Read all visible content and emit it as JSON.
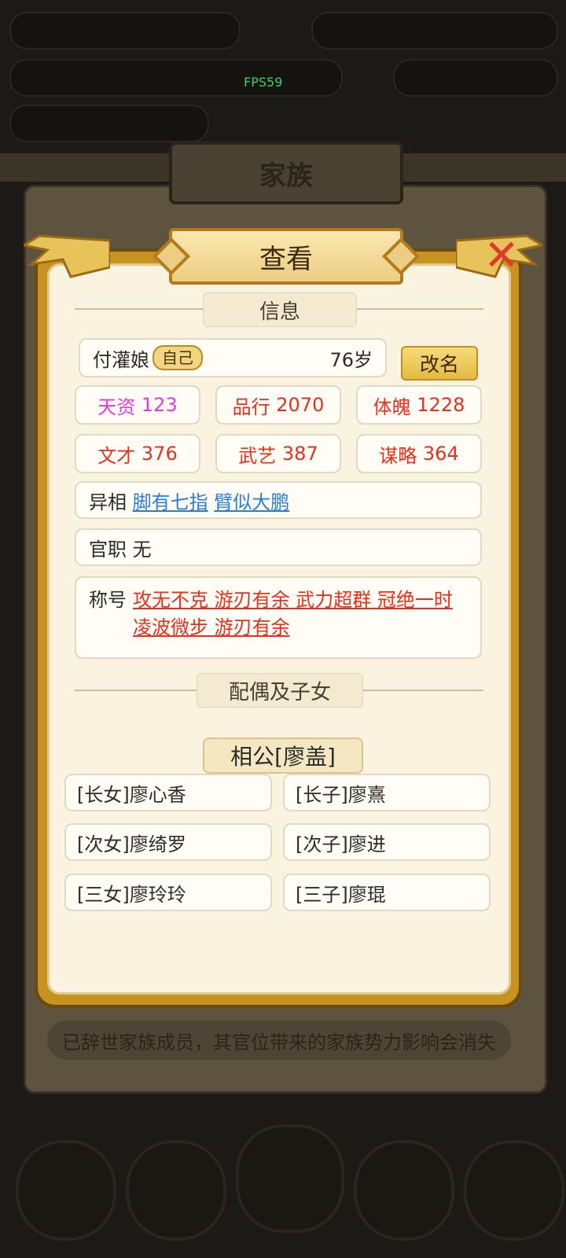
{
  "fps": "FPS59",
  "family_panel": {
    "title": "家族",
    "footer_note": "已辞世家族成员，其官位带来的家族势力影响会消失"
  },
  "dialog": {
    "title": "查看",
    "info_header": "信息",
    "name": "付灌娘",
    "self_badge": "自己",
    "age": "76岁",
    "rename_label": "改名",
    "stats": [
      {
        "label": "天资",
        "value": "123",
        "color": "#e03ce0"
      },
      {
        "label": "品行",
        "value": "2070",
        "color": "#e5301f"
      },
      {
        "label": "体魄",
        "value": "1228",
        "color": "#e5301f"
      },
      {
        "label": "文才",
        "value": "376",
        "color": "#e5301f"
      },
      {
        "label": "武艺",
        "value": "387",
        "color": "#e5301f"
      },
      {
        "label": "谋略",
        "value": "364",
        "color": "#e5301f"
      }
    ],
    "traits": {
      "label": "异相",
      "items": [
        "脚有七指",
        "臂似大鹏"
      ]
    },
    "office": {
      "label": "官职",
      "value": "无"
    },
    "titles": {
      "label": "称号",
      "line1": "攻无不克 游刃有余 武力超群 冠绝一时",
      "line2": "凌波微步 游刃有余"
    },
    "family_header": "配偶及子女",
    "spouse": "相公[廖盖]",
    "children": [
      "[长女]廖心香",
      "[长子]廖熹",
      "[次女]廖绮罗",
      "[次子]廖进",
      "[三女]廖玲玲",
      "[三子]廖琨"
    ]
  },
  "colors": {
    "accent_gold": "#c7921f",
    "panel_cream": "#faf3df",
    "close_red": "#e23a2a",
    "link_blue": "#2a7fd4",
    "title_red": "#e5301f"
  }
}
